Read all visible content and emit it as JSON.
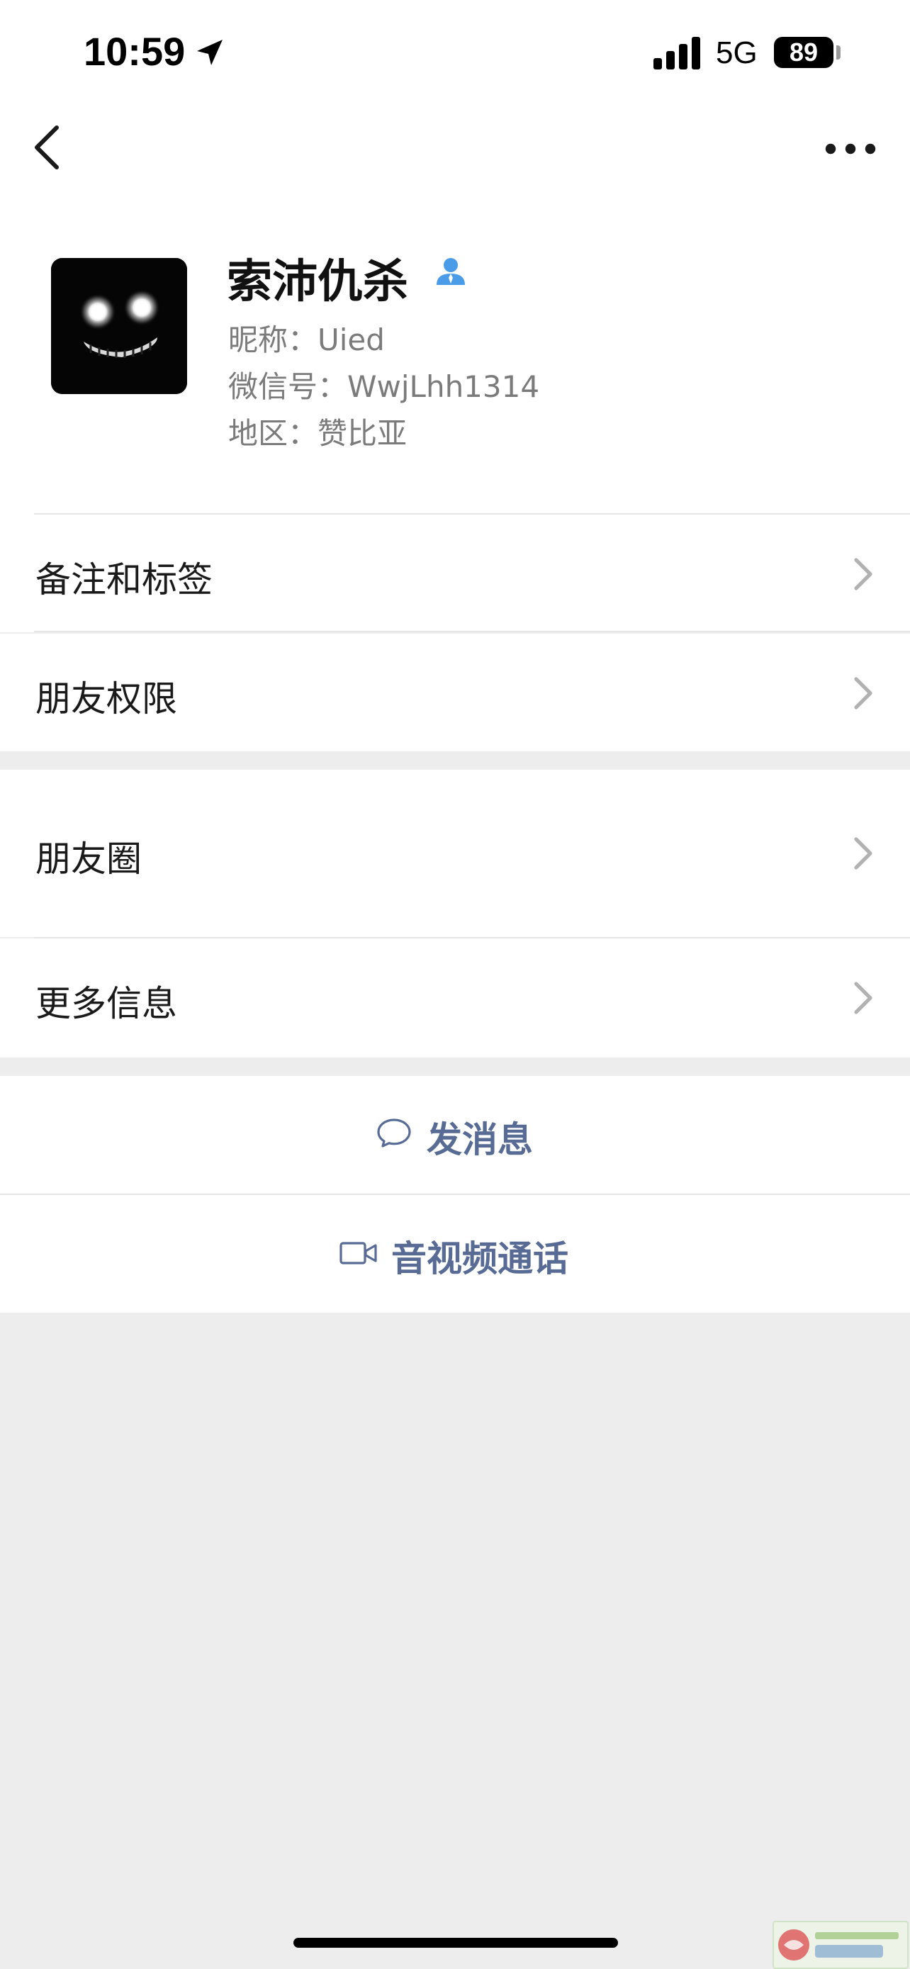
{
  "status_bar": {
    "time": "10:59",
    "network": "5G",
    "battery": "89"
  },
  "icons": {
    "back": "chevron-left-icon",
    "more": "ellipsis-icon",
    "contact_badge": "person-icon",
    "chevron": "chevron-right-icon",
    "message": "chat-bubble-icon",
    "video": "video-camera-icon"
  },
  "profile": {
    "name": "索沛仇杀",
    "nickname": "昵称：Uied",
    "wechat_id": "微信号：WwjLhh1314",
    "region": "地区：赞比亚"
  },
  "rows": {
    "remarks_tags": "备注和标签",
    "friend_permissions": "朋友权限",
    "moments": "朋友圈",
    "more_info": "更多信息"
  },
  "actions": {
    "send_message": "发消息",
    "video_call": "音视频通话"
  },
  "colors": {
    "background": "#ededed",
    "surface": "#ffffff",
    "link_blue": "#576b95",
    "badge_blue": "#4a9be8",
    "secondary_text": "#7b7b7b"
  }
}
